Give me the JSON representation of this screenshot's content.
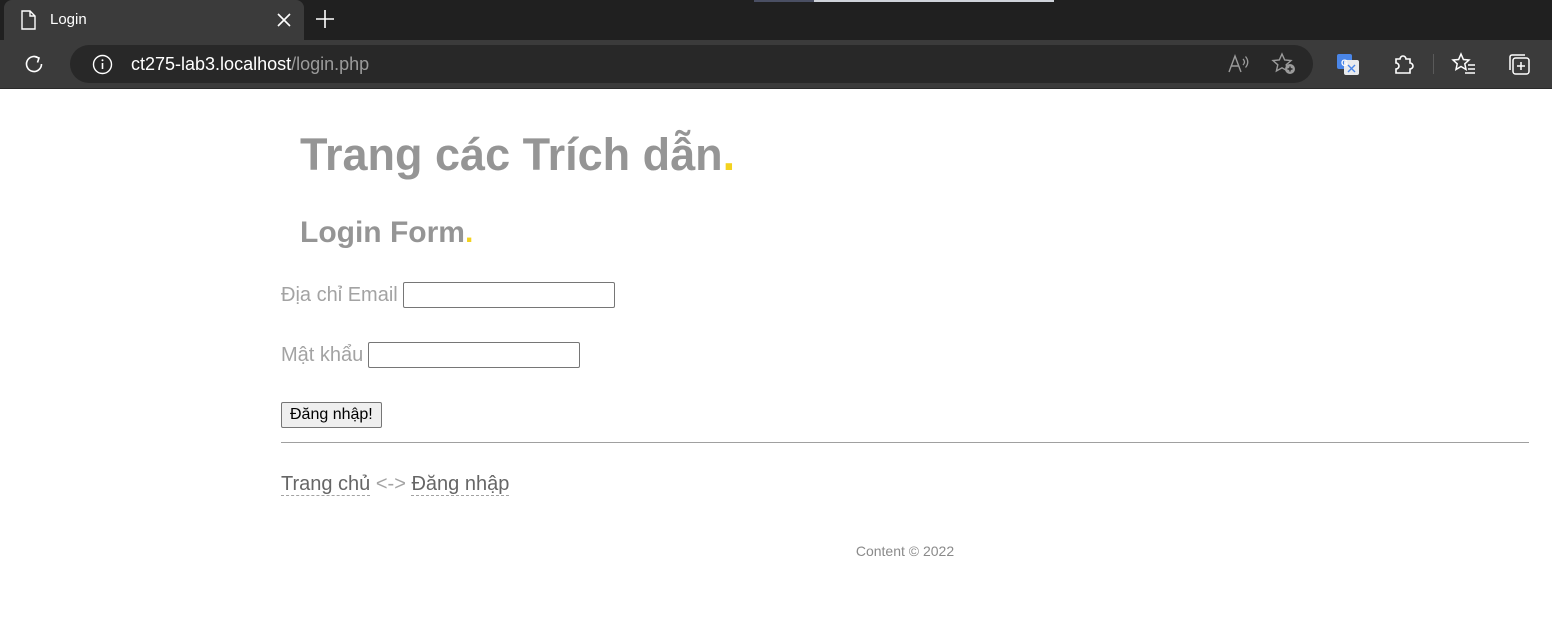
{
  "browser": {
    "tab_title": "Login",
    "url_host": "ct275-lab3.localhost",
    "url_path": "/login.php"
  },
  "page": {
    "site_title": "Trang các Trích dẫn",
    "title_dot": ".",
    "form_title": "Login Form",
    "form_dot": ".",
    "email_label": "Địa chỉ Email",
    "email_value": "",
    "password_label": "Mật khẩu",
    "password_value": "",
    "submit_label": "Đăng nhập!",
    "nav_home": "Trang chủ",
    "nav_separator": " <-> ",
    "nav_login": "Đăng nhập",
    "footer": "Content © 2022"
  },
  "colors": {
    "accent_dot": "#f3d21f",
    "heading": "#959595",
    "chrome_dark": "#202020",
    "chrome_tab": "#3b3b3b"
  }
}
